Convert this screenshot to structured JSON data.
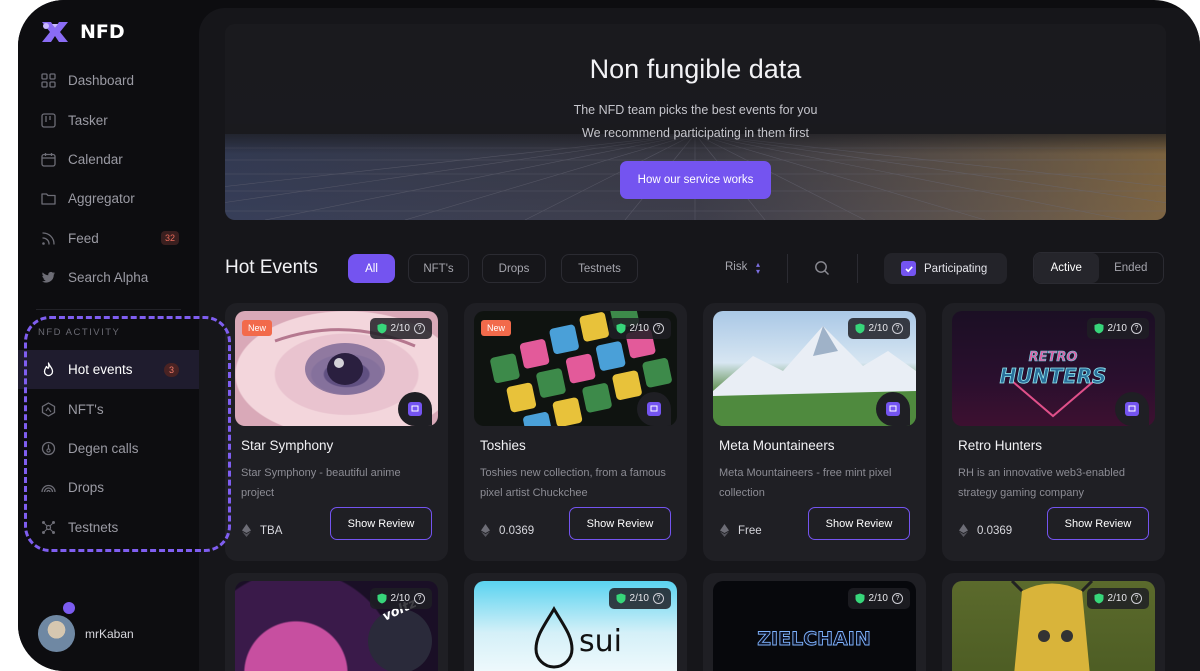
{
  "brand": {
    "name": "NFD"
  },
  "sidebar": {
    "items": [
      {
        "label": "Dashboard",
        "icon": "grid-icon"
      },
      {
        "label": "Tasker",
        "icon": "board-icon"
      },
      {
        "label": "Calendar",
        "icon": "calendar-icon"
      },
      {
        "label": "Aggregator",
        "icon": "folder-icon"
      },
      {
        "label": "Feed",
        "icon": "rss-icon",
        "badge": "32"
      },
      {
        "label": "Search Alpha",
        "icon": "twitter-icon"
      }
    ],
    "section_label": "NFD ACTIVITY",
    "activity_items": [
      {
        "label": "Hot events",
        "icon": "flame-icon",
        "badge": "3",
        "active": true
      },
      {
        "label": "NFT's",
        "icon": "nft-icon"
      },
      {
        "label": "Degen calls",
        "icon": "power-icon"
      },
      {
        "label": "Drops",
        "icon": "rainbow-icon"
      },
      {
        "label": "Testnets",
        "icon": "network-icon"
      }
    ],
    "user": {
      "name": "mrKaban"
    }
  },
  "hero": {
    "title": "Non fungible data",
    "line1": "The NFD team picks the best events for you",
    "line2": "We recommend participating in them first",
    "button": "How our service works"
  },
  "events": {
    "title": "Hot Events",
    "filters": [
      "All",
      "NFT's",
      "Drops",
      "Testnets"
    ],
    "active_filter": "All",
    "risk_label": "Risk",
    "participating_label": "Participating",
    "status_toggle": [
      "Active",
      "Ended"
    ],
    "active_status": "Active",
    "cards": [
      {
        "title": "Star Symphony",
        "desc": "Star Symphony - beautiful anime project",
        "price": "TBA",
        "score": "2/10",
        "new": "New",
        "button": "Show Review"
      },
      {
        "title": "Toshies",
        "desc": "Toshies new collection, from a famous pixel artist Chuckchee",
        "price": "0.0369",
        "score": "2/10",
        "new": "New",
        "button": "Show Review"
      },
      {
        "title": "Meta Mountaineers",
        "desc": "Meta Mountaineers - free mint pixel collection",
        "price": "Free",
        "score": "2/10",
        "button": "Show Review"
      },
      {
        "title": "Retro Hunters",
        "desc": "RH is an innovative web3-enabled strategy gaming company",
        "price": "0.0369",
        "score": "2/10",
        "button": "Show Review",
        "art_text": "RETRO HUNTERS"
      }
    ],
    "row2": [
      {
        "score": "2/10",
        "art_text": "voltz"
      },
      {
        "score": "2/10",
        "art_text": "sui"
      },
      {
        "score": "2/10",
        "art_text": "ZIELCHAIN"
      },
      {
        "score": "2/10"
      }
    ]
  },
  "colors": {
    "accent": "#7454f0",
    "badge": "#f26a4b",
    "shield": "#37d67a"
  }
}
